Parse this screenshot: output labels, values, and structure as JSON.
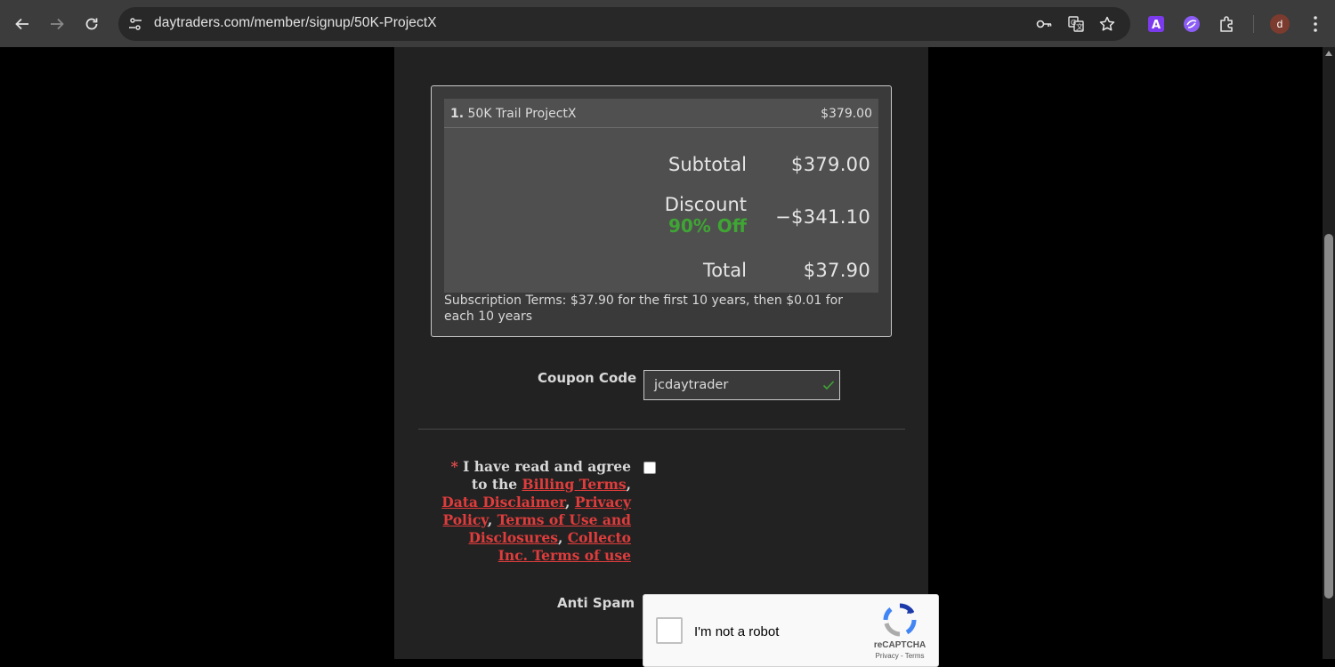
{
  "browser": {
    "url": "daytraders.com/member/signup/50K-ProjectX",
    "avatar_letter": "d"
  },
  "cart": {
    "item_number": "1.",
    "item_name": "50K Trail ProjectX",
    "item_price": "$379.00",
    "subtotal_label": "Subtotal",
    "subtotal_value": "$379.00",
    "discount_label": "Discount",
    "discount_off": "90% Off",
    "discount_value": "−$341.10",
    "total_label": "Total",
    "total_value": "$37.90",
    "terms": "Subscription Terms: $37.90 for the first 10 years, then $0.01 for each 10 years"
  },
  "coupon": {
    "label": "Coupon Code",
    "value": "jcdaytrader"
  },
  "agree": {
    "required_mark": "*",
    "text_1": "I have read and agree to the",
    "link_billing": "Billing Terms",
    "link_data": "Data Disclaimer",
    "link_privacy": "Privacy Policy",
    "link_terms_use": "Terms of Use and Disclosures",
    "link_collecto": "Collecto Inc. Terms of use",
    "comma": ","
  },
  "antispam": {
    "label": "Anti Spam",
    "captcha_text": "I'm not a robot",
    "brand": "reCAPTCHA",
    "links": "Privacy - Terms"
  },
  "colors": {
    "discount_green": "#3fa534",
    "link_red": "#e03c3c",
    "page_bg": "#222222"
  }
}
